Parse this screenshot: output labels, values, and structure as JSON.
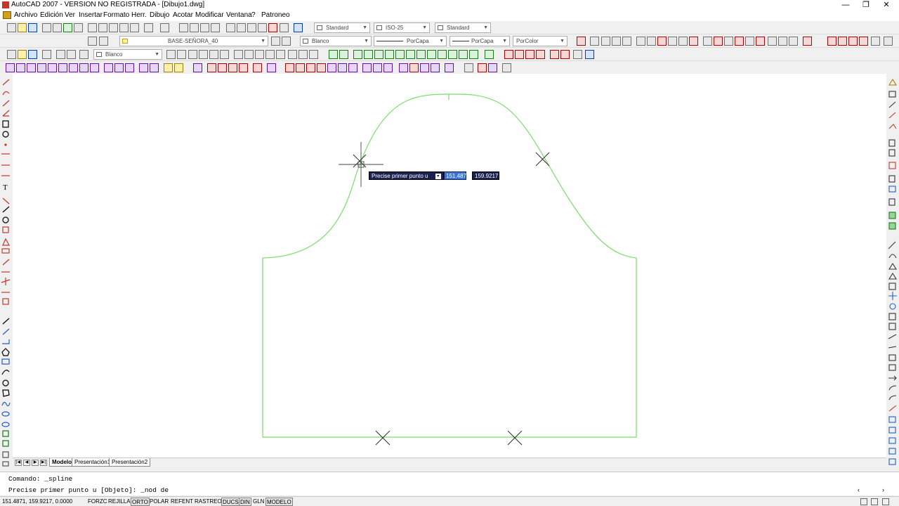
{
  "window": {
    "title": "AutoCAD 2007 - VERSION NO REGISTRADA - [Dibujo1.dwg]",
    "controls": {
      "minimize": "—",
      "restore": "❐",
      "close": "✕"
    }
  },
  "menu": [
    "Archivo",
    "Edición",
    "Ver",
    "Insertar",
    "Formato",
    "Herr.",
    "Dibujo",
    "Acotar",
    "Modificar",
    "Ventana",
    "?",
    "Patroneo"
  ],
  "styles_toolbar": {
    "text_style": "Standard",
    "dim_style": "ISO-25",
    "table_style": "Standard"
  },
  "layers_toolbar": {
    "layer": "BASE-SEÑORA_40",
    "color": "Blanco",
    "linetype": "PorCapa",
    "lineweight": "PorCapa",
    "plotstyle": "PorColor"
  },
  "toolbar3": {
    "color": "Blanco"
  },
  "canvas": {
    "stroke_color": "#7ddc6f",
    "tooltip": {
      "prompt": "Precise primer punto u",
      "x_value": "151.4871",
      "y_value": "159.9217"
    }
  },
  "tabs": {
    "nav": [
      "|◀",
      "◀",
      "▶",
      "▶|"
    ],
    "items": [
      "Modelo",
      "Presentación1",
      "Presentación2"
    ]
  },
  "command": {
    "line1": "Comando: _spline",
    "line2": "Precise primer punto u [Objeto]: _nod de"
  },
  "status": {
    "coords": "151.4871, 159.9217, 0.0000",
    "buttons": [
      "FORZC",
      "REJILLA",
      "ORTO",
      "POLAR",
      "REFENT",
      "RASTREO",
      "DUCS",
      "DIN",
      "GLN",
      "MODELO"
    ]
  }
}
